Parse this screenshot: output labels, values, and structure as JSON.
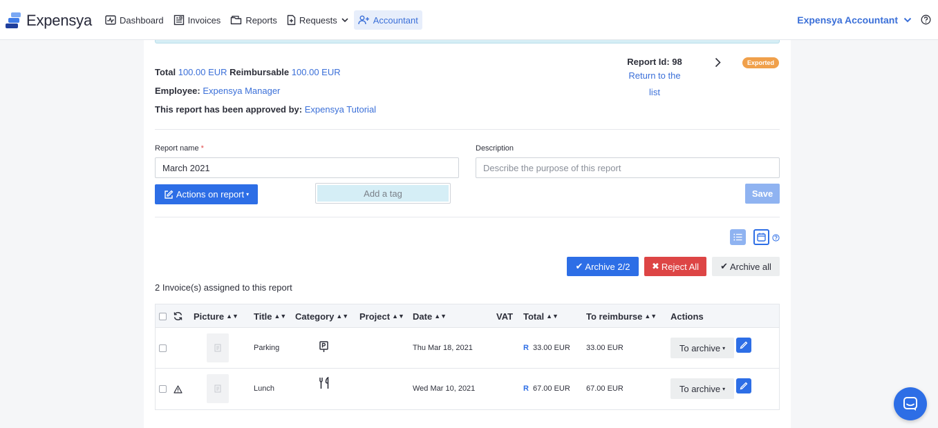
{
  "brand": {
    "name": "Expensya"
  },
  "nav": {
    "dashboard": "Dashboard",
    "invoices": "Invoices",
    "reports": "Reports",
    "requests": "Requests",
    "accountant": "Accountant"
  },
  "account": {
    "name": "Expensya Accountant"
  },
  "summary": {
    "total_label": "Total",
    "total_value": "100.00 EUR",
    "reimbursable_label": "Reimbursable",
    "reimbursable_value": "100.00 EUR",
    "employee_label": "Employee:",
    "employee_value": "Expensya Manager",
    "approved_label": "This report has been approved by:",
    "approved_value": "Expensya Tutorial"
  },
  "report": {
    "id_label": "Report Id: 98",
    "back_link": "Return to the list",
    "status": "Exported"
  },
  "form": {
    "name_label": "Report name",
    "name_required": "*",
    "name_value": "March 2021",
    "description_label": "Description",
    "description_placeholder": "Describe the purpose of this report",
    "actions_button": "Actions on report",
    "tag_placeholder": "Add a tag",
    "save_button": "Save"
  },
  "toolbar": {
    "archive_selected": "Archive 2/2",
    "reject_all": "Reject All",
    "archive_all": "Archive all"
  },
  "invoices_count": "2 Invoice(s) assigned to this report",
  "table": {
    "headers": {
      "picture": "Picture",
      "title": "Title",
      "category": "Category",
      "project": "Project",
      "date": "Date",
      "vat": "VAT",
      "total": "Total",
      "to_reimburse": "To reimburse",
      "actions": "Actions"
    },
    "rows": [
      {
        "title": "Parking",
        "category_icon": "parking-icon",
        "date": "Thu Mar 18, 2021",
        "total_prefix": "R",
        "total": "33.00 EUR",
        "to_reimburse": "33.00 EUR",
        "action": "To archive",
        "warning": false
      },
      {
        "title": "Lunch",
        "category_icon": "restaurant-icon",
        "date": "Wed Mar 10, 2021",
        "total_prefix": "R",
        "total": "67.00 EUR",
        "to_reimburse": "67.00 EUR",
        "action": "To archive",
        "warning": true
      }
    ]
  },
  "colors": {
    "primary": "#2d6ee6",
    "danger": "#dd4545",
    "badge": "#f0a04b",
    "link": "#3a6fd8"
  }
}
